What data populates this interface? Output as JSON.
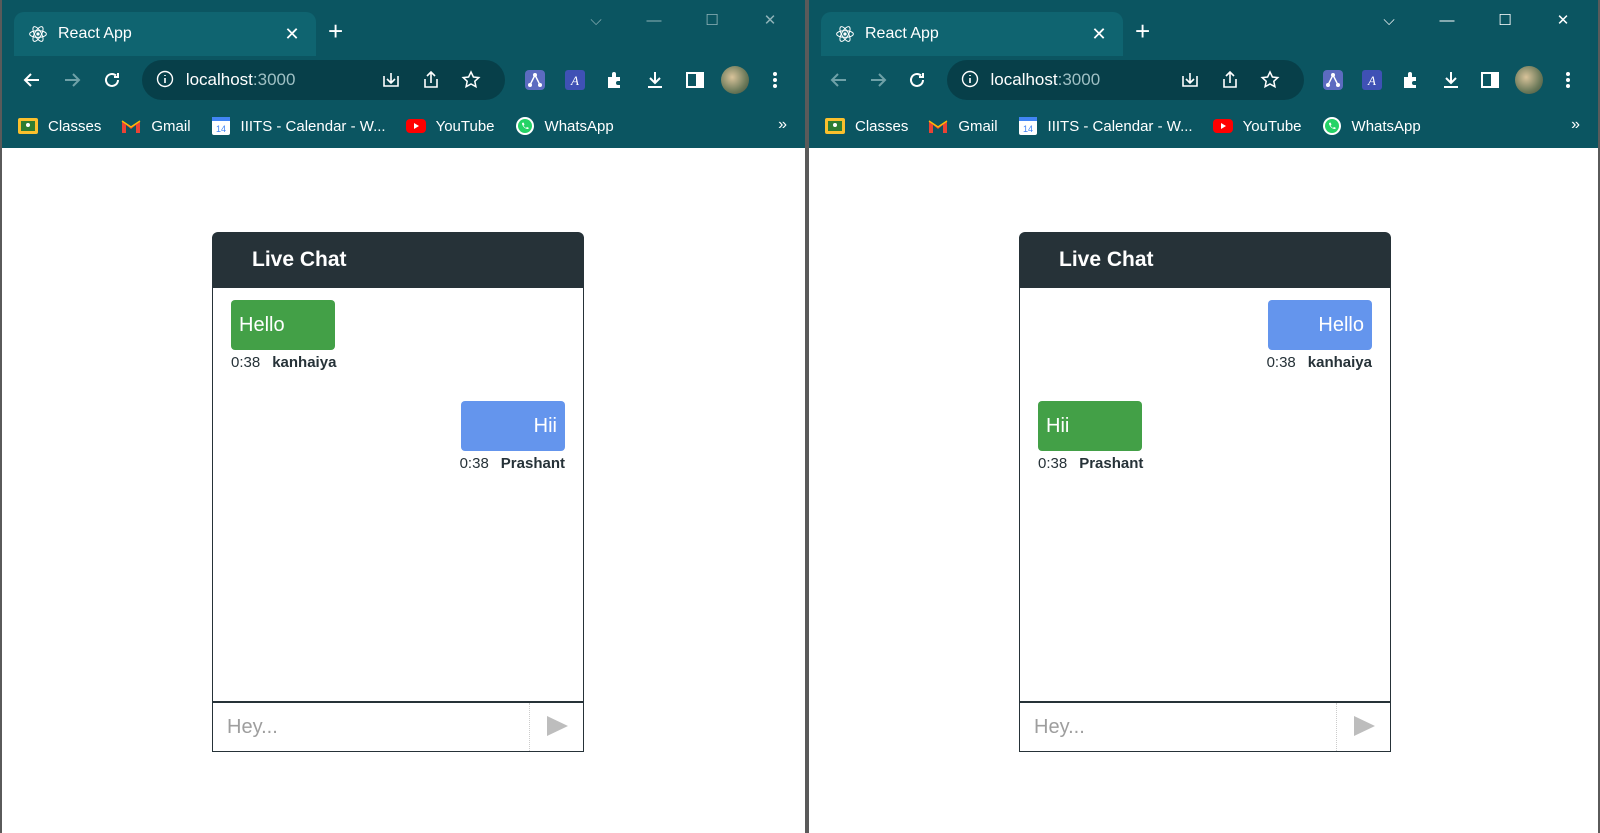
{
  "browser": {
    "tab_title": "React App",
    "tab_close": "✕",
    "new_tab": "+",
    "url_host": "localhost",
    "url_port": ":3000",
    "bookmarks": [
      {
        "label": "Classes"
      },
      {
        "label": "Gmail"
      },
      {
        "label": "IIITS - Calendar - W..."
      },
      {
        "label": "YouTube"
      },
      {
        "label": "WhatsApp"
      }
    ],
    "bookmarks_more": "»"
  },
  "windows": {
    "left": {
      "chat": {
        "title": "Live Chat",
        "messages": [
          {
            "text": "Hello",
            "time": "0:38",
            "author": "kanhaiya",
            "side": "other"
          },
          {
            "text": "Hii",
            "time": "0:38",
            "author": "Prashant",
            "side": "mine"
          }
        ],
        "input_placeholder": "Hey...",
        "input_value": ""
      }
    },
    "right": {
      "chat": {
        "title": "Live Chat",
        "messages": [
          {
            "text": "Hello",
            "time": "0:38",
            "author": "kanhaiya",
            "side": "mine"
          },
          {
            "text": "Hii",
            "time": "0:38",
            "author": "Prashant",
            "side": "other"
          }
        ],
        "input_placeholder": "Hey...",
        "input_value": ""
      }
    }
  },
  "colors": {
    "chrome_bg": "#0b5561",
    "chat_header": "#263238",
    "bubble_other": "#43a047",
    "bubble_mine": "#6495ed"
  }
}
